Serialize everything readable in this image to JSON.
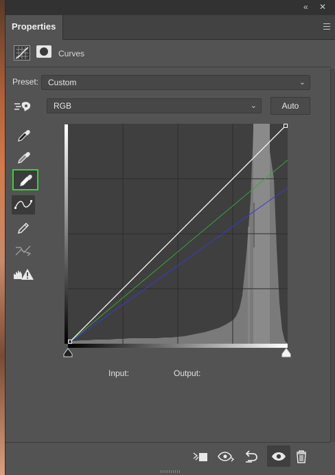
{
  "titlebar": {
    "collapse_glyph": "«",
    "close_glyph": "✕"
  },
  "panel": {
    "tab_label": "Properties",
    "menu_icon": "hamburger-menu-icon"
  },
  "layer": {
    "name": "Curves",
    "adjustment_icon": "curves-adjustment-icon",
    "mask_icon": "layer-mask-icon"
  },
  "preset": {
    "label": "Preset:",
    "value": "Custom"
  },
  "channel": {
    "value": "RGB"
  },
  "auto_button": {
    "label": "Auto"
  },
  "tools": [
    {
      "name": "on-image-adjust-icon"
    },
    {
      "name": "black-point-eyedropper-icon"
    },
    {
      "name": "gray-point-eyedropper-icon"
    },
    {
      "name": "white-point-eyedropper-icon",
      "selected": true
    },
    {
      "name": "curve-points-icon",
      "selected": true
    },
    {
      "name": "pencil-draw-icon"
    },
    {
      "name": "smooth-curve-icon"
    },
    {
      "name": "clipping-warning-icon"
    }
  ],
  "readouts": {
    "input_label": "Input:",
    "output_label": "Output:"
  },
  "bottom_tools": [
    {
      "name": "clip-to-layer-icon"
    },
    {
      "name": "view-previous-state-icon"
    },
    {
      "name": "reset-adjustment-icon"
    },
    {
      "name": "toggle-visibility-icon",
      "active": true
    },
    {
      "name": "delete-adjustment-icon"
    }
  ],
  "colors": {
    "panel_bg": "#535353",
    "graph_bg": "#3f3f3f",
    "histogram": "#7a7a7a",
    "highlight_band": "#8a8a8a",
    "curve_rgb": "#ffffff",
    "curve_red": "#d04a3a",
    "curve_green": "#3aa53a",
    "curve_blue": "#3a3ad0",
    "selected_tool_border": "#38d138"
  },
  "curves": {
    "rgb": [
      [
        0,
        0
      ],
      [
        255,
        255
      ]
    ],
    "red": [
      [
        0,
        0
      ],
      [
        255,
        255
      ]
    ],
    "green": [
      [
        0,
        0
      ],
      [
        255,
        213
      ]
    ],
    "blue": [
      [
        0,
        0
      ],
      [
        255,
        181
      ]
    ]
  }
}
